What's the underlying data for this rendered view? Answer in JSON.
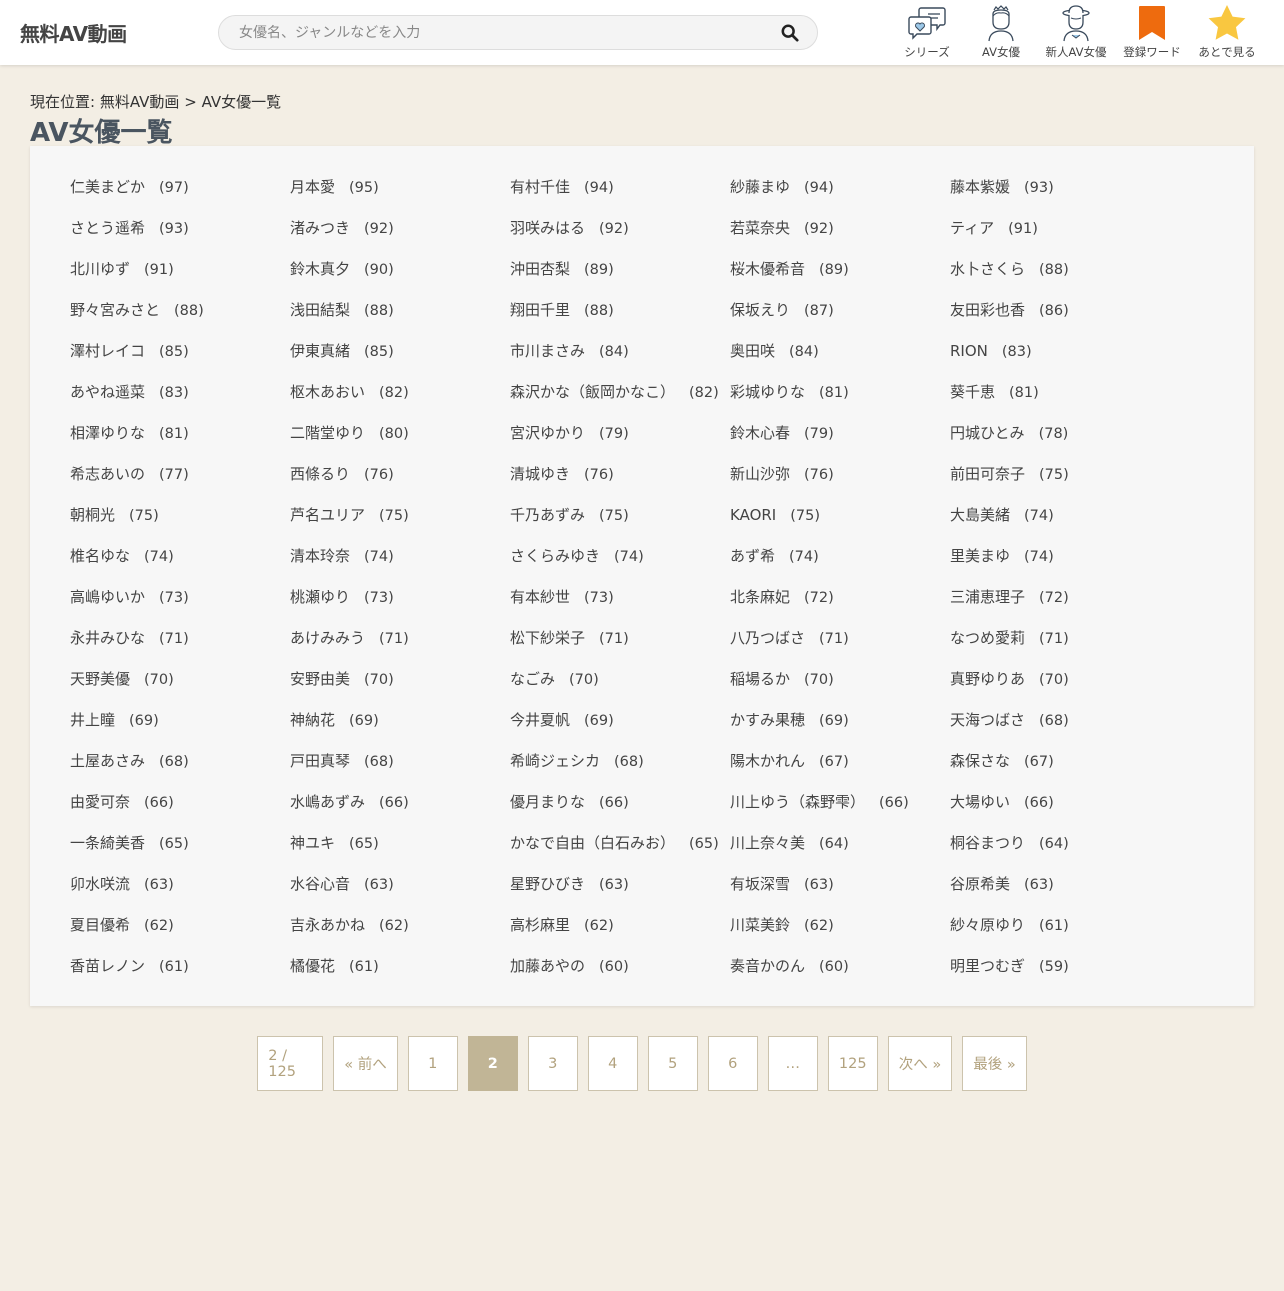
{
  "header": {
    "logo": "無料AV動画",
    "search_placeholder": "女優名、ジャンルなどを入力",
    "nav": [
      {
        "label": "シリーズ",
        "icon": "chat-bubble-heart-icon"
      },
      {
        "label": "AV女優",
        "icon": "actress-outline-icon"
      },
      {
        "label": "新人AV女優",
        "icon": "new-actress-hat-icon"
      },
      {
        "label": "登録ワード",
        "icon": "bookmark-icon"
      },
      {
        "label": "あとで見る",
        "icon": "star-icon"
      }
    ]
  },
  "breadcrumb": {
    "prefix": "現在位置:",
    "home": "無料AV動画",
    "separator": ">",
    "current": "AV女優一覧"
  },
  "page_title": "AV女優一覧",
  "actresses": [
    {
      "name": "仁美まどか",
      "count": "(97)"
    },
    {
      "name": "月本愛",
      "count": "(95)"
    },
    {
      "name": "有村千佳",
      "count": "(94)"
    },
    {
      "name": "紗藤まゆ",
      "count": "(94)"
    },
    {
      "name": "藤本紫媛",
      "count": "(93)"
    },
    {
      "name": "さとう遥希",
      "count": "(93)"
    },
    {
      "name": "渚みつき",
      "count": "(92)"
    },
    {
      "name": "羽咲みはる",
      "count": "(92)"
    },
    {
      "name": "若菜奈央",
      "count": "(92)"
    },
    {
      "name": "ティア",
      "count": "(91)"
    },
    {
      "name": "北川ゆず",
      "count": "(91)"
    },
    {
      "name": "鈴木真夕",
      "count": "(90)"
    },
    {
      "name": "沖田杏梨",
      "count": "(89)"
    },
    {
      "name": "桜木優希音",
      "count": "(89)"
    },
    {
      "name": "水卜さくら",
      "count": "(88)"
    },
    {
      "name": "野々宮みさと",
      "count": "(88)"
    },
    {
      "name": "浅田結梨",
      "count": "(88)"
    },
    {
      "name": "翔田千里",
      "count": "(88)"
    },
    {
      "name": "保坂えり",
      "count": "(87)"
    },
    {
      "name": "友田彩也香",
      "count": "(86)"
    },
    {
      "name": "澤村レイコ",
      "count": "(85)"
    },
    {
      "name": "伊東真緒",
      "count": "(85)"
    },
    {
      "name": "市川まさみ",
      "count": "(84)"
    },
    {
      "name": "奥田咲",
      "count": "(84)"
    },
    {
      "name": "RION",
      "count": "(83)"
    },
    {
      "name": "あやね遥菜",
      "count": "(83)"
    },
    {
      "name": "枢木あおい",
      "count": "(82)"
    },
    {
      "name": "森沢かな（飯岡かなこ）",
      "count": "(82)"
    },
    {
      "name": "彩城ゆりな",
      "count": "(81)"
    },
    {
      "name": "葵千恵",
      "count": "(81)"
    },
    {
      "name": "相澤ゆりな",
      "count": "(81)"
    },
    {
      "name": "二階堂ゆり",
      "count": "(80)"
    },
    {
      "name": "宮沢ゆかり",
      "count": "(79)"
    },
    {
      "name": "鈴木心春",
      "count": "(79)"
    },
    {
      "name": "円城ひとみ",
      "count": "(78)"
    },
    {
      "name": "希志あいの",
      "count": "(77)"
    },
    {
      "name": "西條るり",
      "count": "(76)"
    },
    {
      "name": "清城ゆき",
      "count": "(76)"
    },
    {
      "name": "新山沙弥",
      "count": "(76)"
    },
    {
      "name": "前田可奈子",
      "count": "(75)"
    },
    {
      "name": "朝桐光",
      "count": "(75)"
    },
    {
      "name": "芦名ユリア",
      "count": "(75)"
    },
    {
      "name": "千乃あずみ",
      "count": "(75)"
    },
    {
      "name": "KAORI",
      "count": "(75)"
    },
    {
      "name": "大島美緒",
      "count": "(74)"
    },
    {
      "name": "椎名ゆな",
      "count": "(74)"
    },
    {
      "name": "清本玲奈",
      "count": "(74)"
    },
    {
      "name": "さくらみゆき",
      "count": "(74)"
    },
    {
      "name": "あず希",
      "count": "(74)"
    },
    {
      "name": "里美まゆ",
      "count": "(74)"
    },
    {
      "name": "高嶋ゆいか",
      "count": "(73)"
    },
    {
      "name": "桃瀬ゆり",
      "count": "(73)"
    },
    {
      "name": "有本紗世",
      "count": "(73)"
    },
    {
      "name": "北条麻妃",
      "count": "(72)"
    },
    {
      "name": "三浦恵理子",
      "count": "(72)"
    },
    {
      "name": "永井みひな",
      "count": "(71)"
    },
    {
      "name": "あけみみう",
      "count": "(71)"
    },
    {
      "name": "松下紗栄子",
      "count": "(71)"
    },
    {
      "name": "八乃つばさ",
      "count": "(71)"
    },
    {
      "name": "なつめ愛莉",
      "count": "(71)"
    },
    {
      "name": "天野美優",
      "count": "(70)"
    },
    {
      "name": "安野由美",
      "count": "(70)"
    },
    {
      "name": "なごみ",
      "count": "(70)"
    },
    {
      "name": "稲場るか",
      "count": "(70)"
    },
    {
      "name": "真野ゆりあ",
      "count": "(70)"
    },
    {
      "name": "井上瞳",
      "count": "(69)"
    },
    {
      "name": "神納花",
      "count": "(69)"
    },
    {
      "name": "今井夏帆",
      "count": "(69)"
    },
    {
      "name": "かすみ果穂",
      "count": "(69)"
    },
    {
      "name": "天海つばさ",
      "count": "(68)"
    },
    {
      "name": "土屋あさみ",
      "count": "(68)"
    },
    {
      "name": "戸田真琴",
      "count": "(68)"
    },
    {
      "name": "希崎ジェシカ",
      "count": "(68)"
    },
    {
      "name": "陽木かれん",
      "count": "(67)"
    },
    {
      "name": "森保さな",
      "count": "(67)"
    },
    {
      "name": "由愛可奈",
      "count": "(66)"
    },
    {
      "name": "水嶋あずみ",
      "count": "(66)"
    },
    {
      "name": "優月まりな",
      "count": "(66)"
    },
    {
      "name": "川上ゆう（森野雫）",
      "count": "(66)"
    },
    {
      "name": "大場ゆい",
      "count": "(66)"
    },
    {
      "name": "一条綺美香",
      "count": "(65)"
    },
    {
      "name": "神ユキ",
      "count": "(65)"
    },
    {
      "name": "かなで自由（白石みお）",
      "count": "(65)"
    },
    {
      "name": "川上奈々美",
      "count": "(64)"
    },
    {
      "name": "桐谷まつり",
      "count": "(64)"
    },
    {
      "name": "卯水咲流",
      "count": "(63)"
    },
    {
      "name": "水谷心音",
      "count": "(63)"
    },
    {
      "name": "星野ひびき",
      "count": "(63)"
    },
    {
      "name": "有坂深雪",
      "count": "(63)"
    },
    {
      "name": "谷原希美",
      "count": "(63)"
    },
    {
      "name": "夏目優希",
      "count": "(62)"
    },
    {
      "name": "吉永あかね",
      "count": "(62)"
    },
    {
      "name": "高杉麻里",
      "count": "(62)"
    },
    {
      "name": "川菜美鈴",
      "count": "(62)"
    },
    {
      "name": "紗々原ゆり",
      "count": "(61)"
    },
    {
      "name": "香苗レノン",
      "count": "(61)"
    },
    {
      "name": "橘優花",
      "count": "(61)"
    },
    {
      "name": "加藤あやの",
      "count": "(60)"
    },
    {
      "name": "奏音かのん",
      "count": "(60)"
    },
    {
      "name": "明里つむぎ",
      "count": "(59)"
    }
  ],
  "pagination": {
    "info": "2 / 125",
    "prev": "« 前へ",
    "pages": [
      "1",
      "2",
      "3",
      "4",
      "5",
      "6",
      "…",
      "125"
    ],
    "current": "2",
    "next": "次へ »",
    "last": "最後 »"
  },
  "colors": {
    "background": "#f3eee4",
    "pagination_accent": "#c1b596",
    "pagination_text": "#b2a27e",
    "bookmark": "#ee6b0e",
    "star": "#f9c740"
  }
}
